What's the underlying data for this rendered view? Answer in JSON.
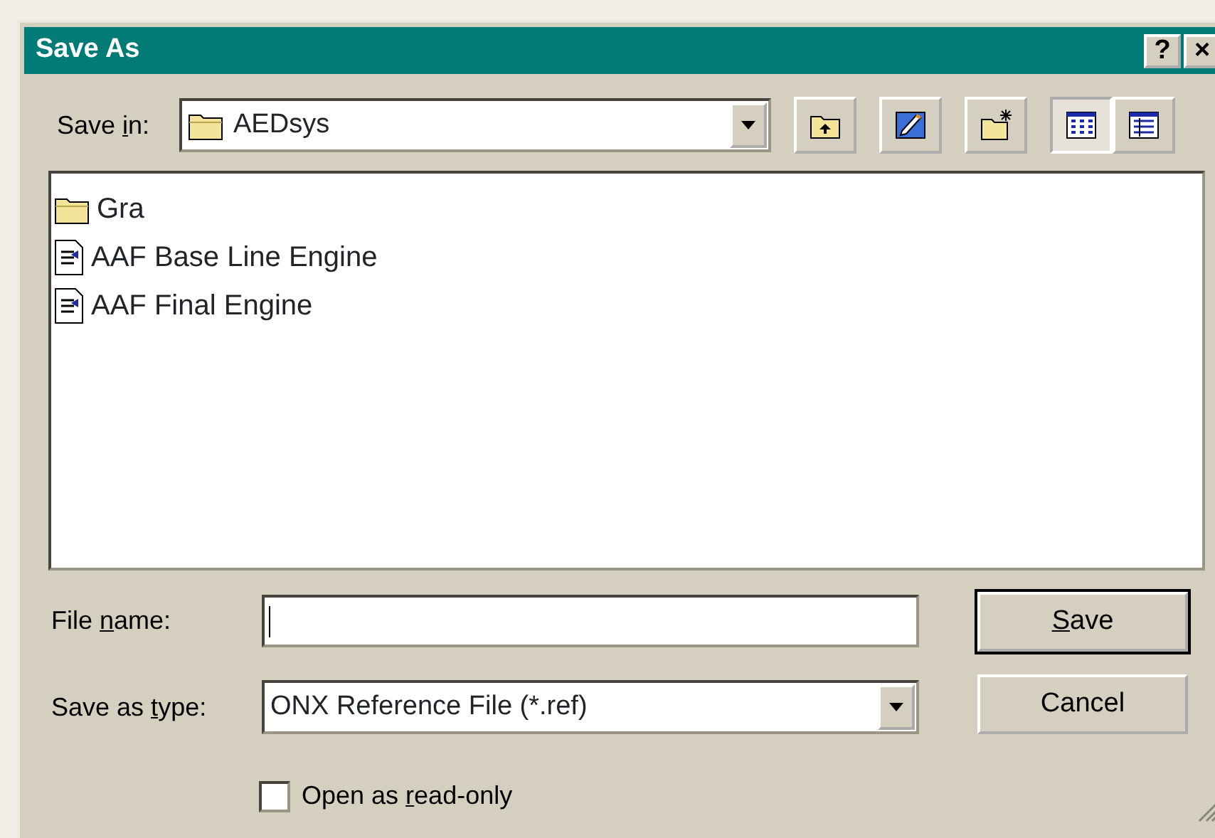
{
  "window": {
    "title": "Save As",
    "buttons": [
      {
        "label": "?"
      },
      {
        "label": "×"
      }
    ]
  },
  "save_in": {
    "label": {
      "before": "Save ",
      "hotkey": "i",
      "after": "n:"
    },
    "value": "AEDsys"
  },
  "toolbar": [
    {
      "kind": "up-folder",
      "pressed": false
    },
    {
      "kind": "desktop",
      "pressed": false
    },
    {
      "kind": "new-folder",
      "pressed": false
    },
    {
      "kind": "list-view",
      "pressed": true
    },
    {
      "kind": "details-view",
      "pressed": false
    }
  ],
  "files": [
    {
      "kind": "folder",
      "name": "Gra"
    },
    {
      "kind": "document",
      "name": "AAF Base Line Engine"
    },
    {
      "kind": "document",
      "name": "AAF Final Engine"
    }
  ],
  "file_name": {
    "label": {
      "before": "File ",
      "hotkey": "n",
      "after": "ame:"
    }
  },
  "save_as_type": {
    "label": {
      "before": "Save as ",
      "hotkey": "t",
      "after": "ype:"
    },
    "value": "ONX Reference File  (*.ref)"
  },
  "read_only": {
    "label": {
      "before": "Open as ",
      "hotkey": "r",
      "after": "ead-only"
    },
    "checked": false
  },
  "buttons": [
    {
      "label": {
        "hotkey": "S",
        "after": "ave"
      },
      "default": true
    },
    {
      "label": {
        "before": "Cancel"
      },
      "default": false
    }
  ]
}
